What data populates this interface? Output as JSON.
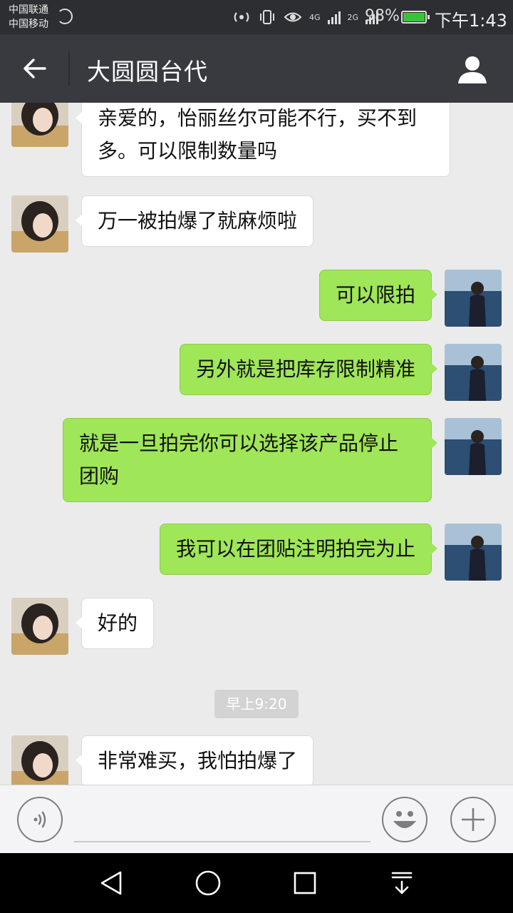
{
  "status_bar": {
    "carrier_1": "中国联通",
    "carrier_2": "中国移动",
    "net_1": "4G",
    "net_2": "2G",
    "battery": "98%",
    "time": "下午1:43",
    "battery_color": "#35c53a"
  },
  "header": {
    "title": "大圆圆台代",
    "back_icon": "arrow-left-icon",
    "profile_icon": "person-icon"
  },
  "messages": [
    {
      "side": "in",
      "text": "亲爱的，怡丽丝尔可能不行，买不到多。可以限制数量吗"
    },
    {
      "side": "in",
      "text": "万一被拍爆了就麻烦啦"
    },
    {
      "side": "out",
      "text": "可以限拍"
    },
    {
      "side": "out",
      "text": "另外就是把库存限制精准"
    },
    {
      "side": "out",
      "text": "就是一旦拍完你可以选择该产品停止团购"
    },
    {
      "side": "out",
      "text": "我可以在团贴注明拍完为止"
    },
    {
      "side": "in",
      "text": "好的"
    },
    {
      "side": "in",
      "text": "非常难买，我怕拍爆了"
    }
  ],
  "timestamp": "早上9:20",
  "input_bar": {
    "placeholder": "",
    "voice_icon": "voice-icon",
    "emoji_icon": "smiley-icon",
    "plus_icon": "plus-icon"
  },
  "colors": {
    "outgoing_bubble": "#9fe658",
    "incoming_bubble": "#ffffff",
    "header_bg": "#393a3f"
  }
}
